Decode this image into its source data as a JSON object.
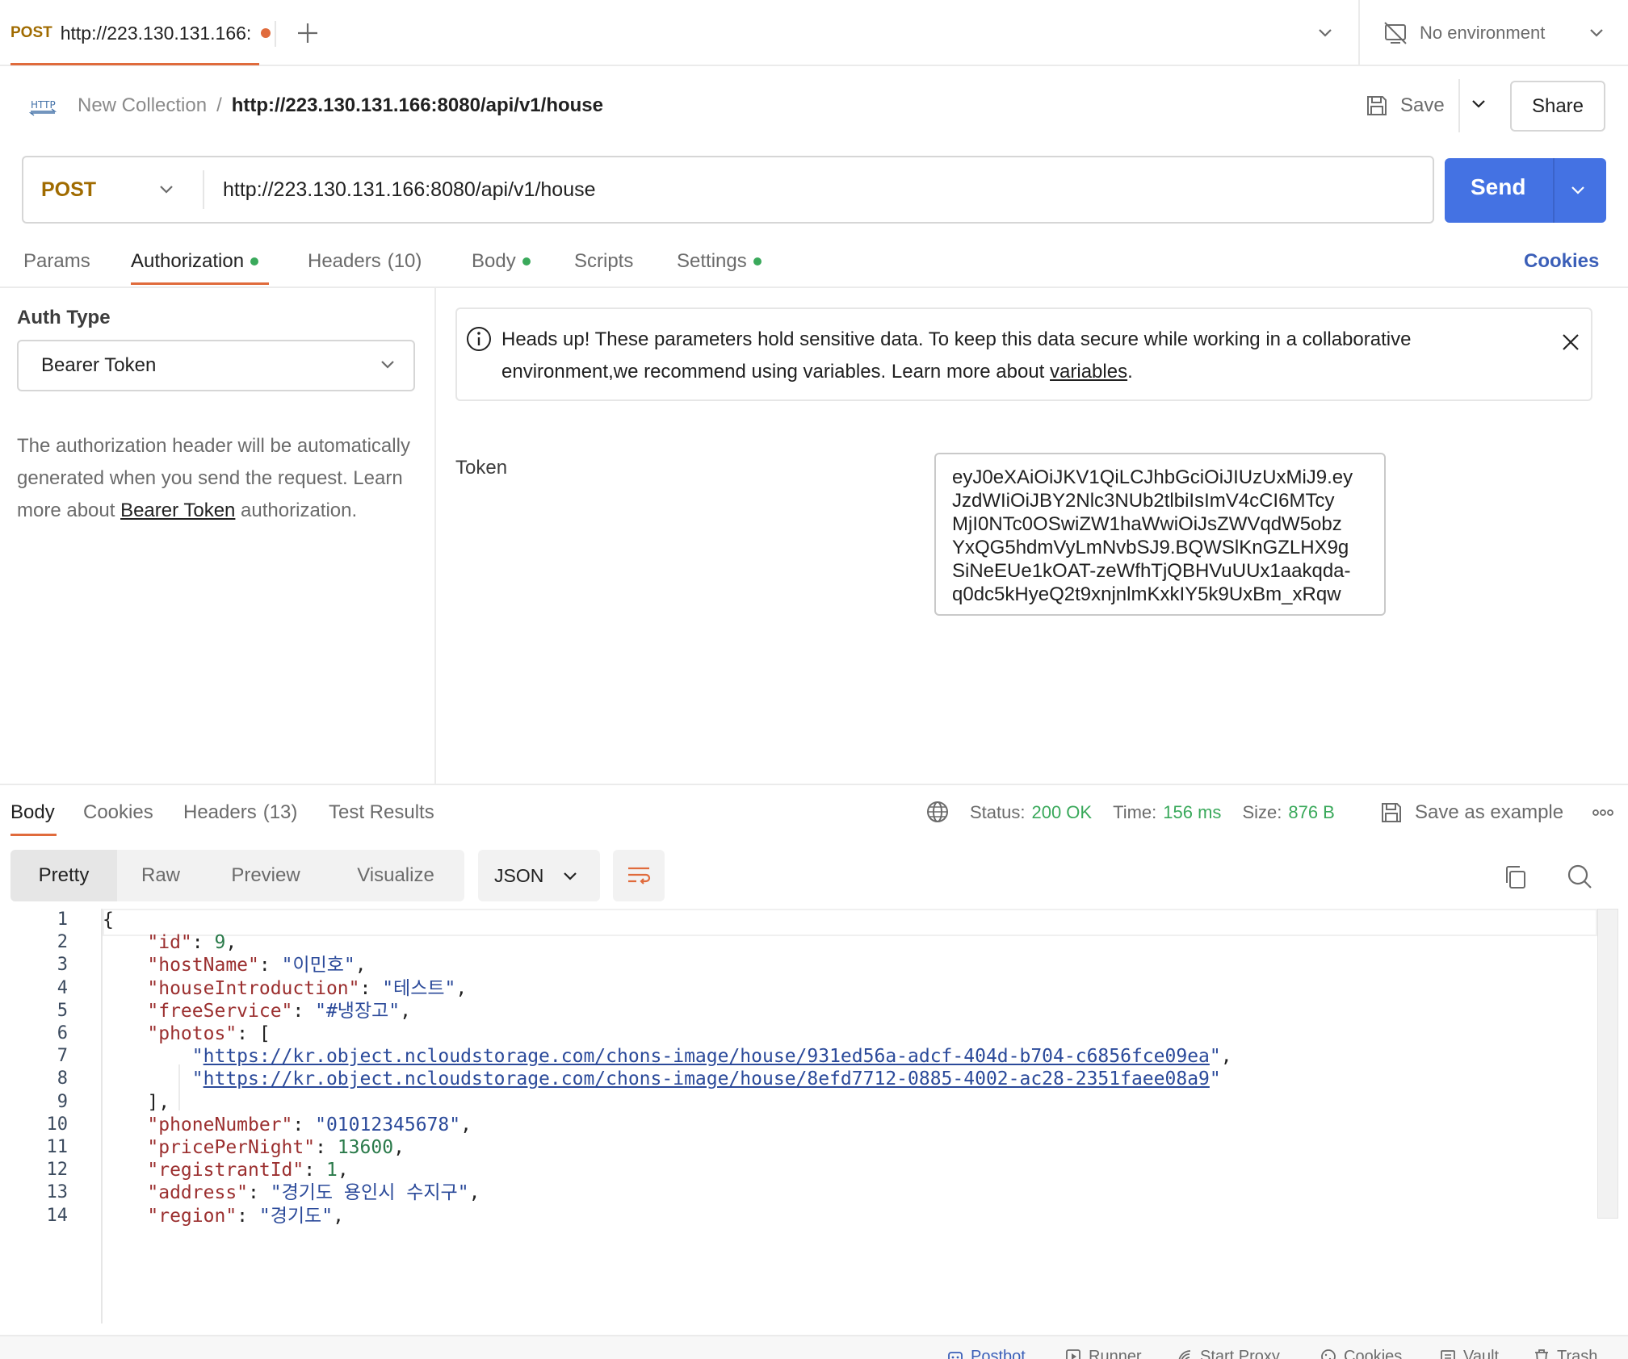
{
  "tab": {
    "method": "POST",
    "url": "http://223.130.131.166:",
    "unsaved_color": "#e06b3c"
  },
  "environment": {
    "label": "No environment"
  },
  "breadcrumb": {
    "collection": "New Collection",
    "separator": "/",
    "request_name": "http://223.130.131.166:8080/api/v1/house"
  },
  "toolbar": {
    "save_label": "Save",
    "share_label": "Share"
  },
  "request": {
    "method": "POST",
    "url": "http://223.130.131.166:8080/api/v1/house",
    "send_label": "Send"
  },
  "request_tabs": {
    "params": "Params",
    "authorization": "Authorization",
    "headers": "Headers",
    "headers_count": "(10)",
    "body": "Body",
    "scripts": "Scripts",
    "settings": "Settings",
    "cookies": "Cookies"
  },
  "auth": {
    "type_label": "Auth Type",
    "type_value": "Bearer Token",
    "desc_before": "The authorization header will be automatically generated when you send the request. Learn more about ",
    "desc_link": "Bearer Token",
    "desc_after": " authorization.",
    "banner_before": "Heads up! These parameters hold sensitive data. To keep this data secure while working in a collaborative environment,we recommend using variables. Learn more about ",
    "banner_link": "variables",
    "banner_after": ".",
    "token_label": "Token",
    "token_value": "eyJ0eXAiOiJKV1QiLCJhbGciOiJIUzUxMiJ9.ey\nJzdWIiOiJBY2Nlc3NUb2tlbiIsImV4cCI6MTcy\nMjI0NTc0OSwiZW1haWwiOiJsZWVqdW5obz\nYxQG5hdmVyLmNvbSJ9.BQWSlKnGZLHX9g\nSiNeEUe1kOAT-zeWfhTjQBHVuUUx1aakqda-\nq0dc5kHyeQ2t9xnjnlmKxkIY5k9UxBm_xRqw"
  },
  "response_tabs": {
    "body": "Body",
    "cookies": "Cookies",
    "headers": "Headers",
    "headers_count": "(13)",
    "test_results": "Test Results"
  },
  "response_meta": {
    "status_label": "Status:",
    "status_value": "200 OK",
    "time_label": "Time:",
    "time_value": "156 ms",
    "size_label": "Size:",
    "size_value": "876 B",
    "save_example": "Save as example"
  },
  "view_modes": {
    "pretty": "Pretty",
    "raw": "Raw",
    "preview": "Preview",
    "visualize": "Visualize",
    "format": "JSON"
  },
  "code_lines": [
    {
      "n": "1",
      "html": "{"
    },
    {
      "n": "2",
      "key": "\"id\"",
      "sep": ": ",
      "num": "9",
      "tail": ","
    },
    {
      "n": "3",
      "key": "\"hostName\"",
      "sep": ": ",
      "str": "\"이민호\"",
      "tail": ","
    },
    {
      "n": "4",
      "key": "\"houseIntroduction\"",
      "sep": ": ",
      "str": "\"테스트\"",
      "tail": ","
    },
    {
      "n": "5",
      "key": "\"freeService\"",
      "sep": ": ",
      "str": "\"#냉장고\"",
      "tail": ","
    },
    {
      "n": "6",
      "key": "\"photos\"",
      "sep": ": ",
      "tail": "["
    },
    {
      "n": "7",
      "url": "https://kr.object.ncloudstorage.com/chons-image/house/931ed56a-adcf-404d-b704-c6856fce09ea",
      "tail": ","
    },
    {
      "n": "8",
      "url": "https://kr.object.ncloudstorage.com/chons-image/house/8efd7712-0885-4002-ac28-2351faee08a9",
      "tail": ""
    },
    {
      "n": "9",
      "html": "],"
    },
    {
      "n": "10",
      "key": "\"phoneNumber\"",
      "sep": ": ",
      "str": "\"01012345678\"",
      "tail": ","
    },
    {
      "n": "11",
      "key": "\"pricePerNight\"",
      "sep": ": ",
      "num": "13600",
      "tail": ","
    },
    {
      "n": "12",
      "key": "\"registrantId\"",
      "sep": ": ",
      "num": "1",
      "tail": ","
    },
    {
      "n": "13",
      "key": "\"address\"",
      "sep": ": ",
      "str": "\"경기도 용인시 수지구\"",
      "tail": ","
    },
    {
      "n": "14",
      "key": "\"region\"",
      "sep": ": ",
      "str": "\"경기도\"",
      "tail": ","
    }
  ],
  "footer": {
    "postbot": "Postbot",
    "runner": "Runner",
    "start_proxy": "Start Proxy",
    "cookies": "Cookies",
    "vault": "Vault",
    "trash": "Trash"
  },
  "colors": {
    "accent": "#e06b3c",
    "send": "#4472e3",
    "method": "#a06b00",
    "success": "#3aa95b",
    "link": "#3b5fb8"
  }
}
